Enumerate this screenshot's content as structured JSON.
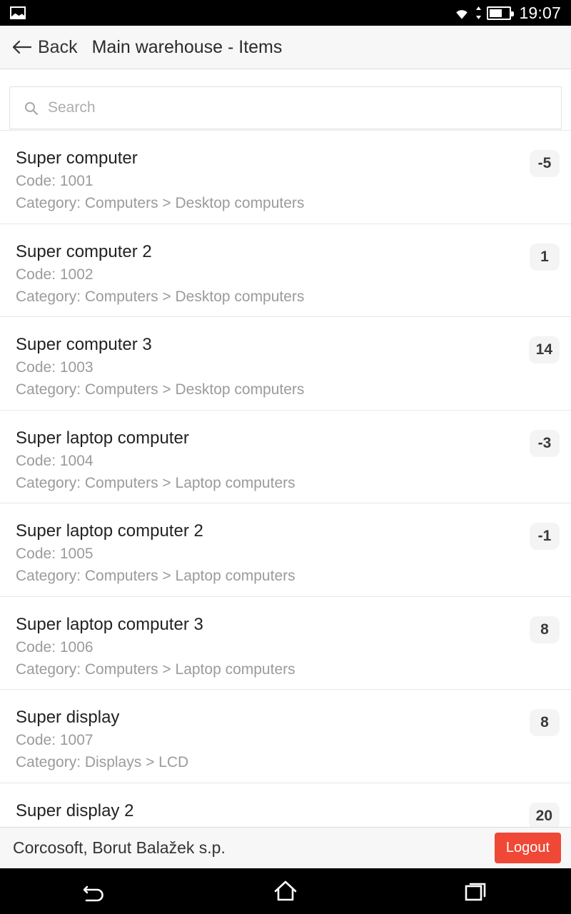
{
  "status_bar": {
    "left_icon": "photo-icon",
    "wifi_icon": "wifi-icon",
    "data_arrows_icon": "data-transfer-arrows-icon",
    "battery_icon": "battery-icon",
    "battery_level_percent": 62,
    "time": "19:07"
  },
  "app_bar": {
    "back_icon": "back-arrow-icon",
    "back_label": "Back",
    "title": "Main warehouse - Items"
  },
  "search": {
    "icon": "search-icon",
    "placeholder": "Search",
    "value": ""
  },
  "items": [
    {
      "title": "Super computer",
      "code_label": "Code: 1001",
      "category_label": "Category: Computers > Desktop computers",
      "quantity": "-5"
    },
    {
      "title": "Super computer 2",
      "code_label": "Code: 1002",
      "category_label": "Category: Computers > Desktop computers",
      "quantity": "1"
    },
    {
      "title": "Super computer 3",
      "code_label": "Code: 1003",
      "category_label": "Category: Computers > Desktop computers",
      "quantity": "14"
    },
    {
      "title": "Super laptop computer",
      "code_label": "Code: 1004",
      "category_label": "Category: Computers > Laptop computers",
      "quantity": "-3"
    },
    {
      "title": "Super laptop computer 2",
      "code_label": "Code: 1005",
      "category_label": "Category: Computers > Laptop computers",
      "quantity": "-1"
    },
    {
      "title": "Super laptop computer 3",
      "code_label": "Code: 1006",
      "category_label": "Category: Computers > Laptop computers",
      "quantity": "8"
    },
    {
      "title": "Super display",
      "code_label": "Code: 1007",
      "category_label": "Category: Displays > LCD",
      "quantity": "8"
    },
    {
      "title": "Super display 2",
      "code_label": "",
      "category_label": "",
      "quantity": "20"
    }
  ],
  "footer": {
    "company": "Corcosoft, Borut Balažek s.p.",
    "logout_label": "Logout",
    "logout_color": "#ef4836"
  },
  "nav_bar": {
    "back_icon": "android-back-icon",
    "home_icon": "android-home-icon",
    "recents_icon": "android-recents-icon"
  }
}
